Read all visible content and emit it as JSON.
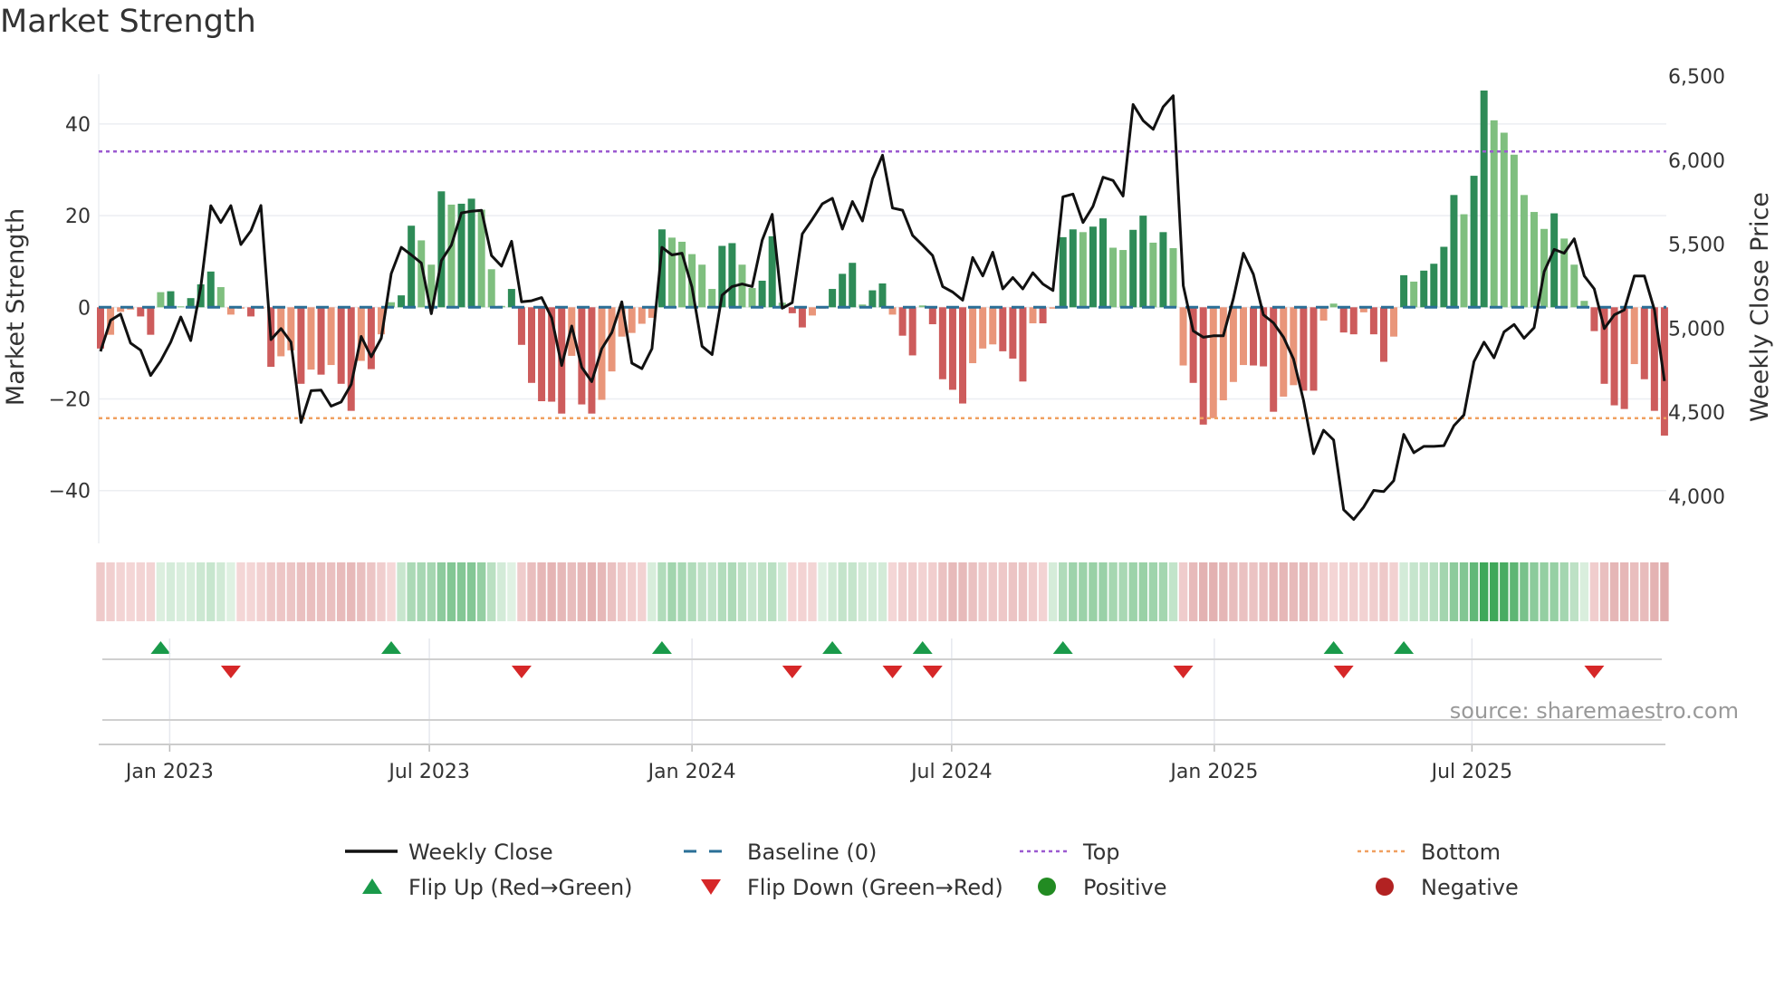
{
  "title": "Market Strength",
  "source": "source: sharemaestro.com",
  "chart_data": {
    "type": "bar",
    "title": "Market Strength",
    "ylabel": "Market Strength",
    "y2label": "Weekly Close Price",
    "ylim": [
      -52,
      52
    ],
    "y2lim": [
      3740,
      6540
    ],
    "yticks": [
      40,
      20,
      0,
      -20,
      -40
    ],
    "yticks_labels": [
      "40",
      "20",
      "0",
      "−20",
      "−40"
    ],
    "y2ticks": [
      6500,
      6000,
      5500,
      5000,
      4500,
      4000
    ],
    "y2ticks_labels": [
      "6,500",
      "6,000",
      "5,500",
      "5,000",
      "4,500",
      "4,000"
    ],
    "xticks_week_index": [
      6.9,
      32.8,
      59,
      84.9,
      111.1,
      136.8
    ],
    "xticks_labels": [
      "Jan 2023",
      "Jul 2023",
      "Jan 2024",
      "Jul 2024",
      "Jan 2025",
      "Jul 2025"
    ],
    "top_level": 34,
    "bottom_level": -24.2,
    "baseline": 0,
    "strength": [
      -9,
      -6,
      -1,
      -0.5,
      -2,
      -6,
      3.3,
      3.5,
      0.2,
      2,
      5,
      7.8,
      4.4,
      -1.6,
      -0.3,
      -2,
      -0.3,
      -13,
      -10.7,
      -9.4,
      -16.7,
      -13.6,
      -14.7,
      -12.6,
      -16.7,
      -22.6,
      -11.7,
      -13.5,
      -5.9,
      1.1,
      2.6,
      17.8,
      14.6,
      9.3,
      25.3,
      22.4,
      22.6,
      23.7,
      21.3,
      8.3,
      0.3,
      4,
      -8.2,
      -16.5,
      -20.5,
      -20.6,
      -23.2,
      -10.6,
      -21.2,
      -23.2,
      -20.2,
      -14,
      -6.4,
      -5.6,
      -3.6,
      -2.3,
      17,
      15.2,
      14.3,
      11.6,
      9.3,
      4,
      13.4,
      14,
      9.3,
      4.2,
      5.8,
      15.5,
      1,
      -1.3,
      -4.4,
      -1.8,
      -0.3,
      4,
      7.3,
      9.7,
      0.6,
      3.7,
      5.2,
      -1.6,
      -6.2,
      -10.5,
      0.4,
      -3.7,
      -15.7,
      -18,
      -21,
      -12.2,
      -9,
      -8.1,
      -9.6,
      -11.2,
      -16.2,
      -3.5,
      -3.5,
      -0.3,
      15.3,
      17,
      16.4,
      17.6,
      19.4,
      13,
      12.5,
      16.9,
      20,
      14.1,
      16.4,
      12.9,
      -12.7,
      -16.5,
      -25.6,
      -24.2,
      -20.3,
      -16.3,
      -12.6,
      -12.7,
      -12.9,
      -22.8,
      -19.5,
      -17,
      -18.2,
      -18.2,
      -2.9,
      0.8,
      -5.5,
      -5.9,
      -1.1,
      -5.9,
      -11.9,
      -6.4,
      7,
      5.6,
      8,
      9.5,
      13.2,
      24.5,
      20.3,
      28.7,
      47.3,
      40.8,
      38.1,
      33.3,
      24.5,
      20.8,
      17.1,
      20.5,
      15,
      9.3,
      1.4,
      -5.2,
      -16.7,
      -21.4,
      -22.2,
      -12.4,
      -15.7,
      -22.6,
      -28
    ],
    "weekly_close": [
      4862,
      5047,
      5084,
      4911,
      4869,
      4719,
      4805,
      4917,
      5067,
      4926,
      5244,
      5729,
      5629,
      5729,
      5498,
      5580,
      5730,
      4932,
      4998,
      4917,
      4439,
      4628,
      4632,
      4536,
      4561,
      4666,
      4951,
      4830,
      4940,
      5325,
      5481,
      5436,
      5388,
      5086,
      5402,
      5494,
      5686,
      5696,
      5701,
      5432,
      5369,
      5517,
      5157,
      5163,
      5182,
      5061,
      4778,
      5013,
      4767,
      4682,
      4878,
      4974,
      5157,
      4792,
      4759,
      4878,
      5481,
      5436,
      5446,
      5244,
      4893,
      4843,
      5196,
      5248,
      5263,
      5248,
      5523,
      5677,
      5119,
      5152,
      5561,
      5648,
      5740,
      5773,
      5590,
      5754,
      5638,
      5888,
      6029,
      5715,
      5702,
      5552,
      5494,
      5432,
      5248,
      5215,
      5167,
      5421,
      5311,
      5452,
      5234,
      5301,
      5234,
      5330,
      5263,
      5224,
      5782,
      5798,
      5629,
      5725,
      5898,
      5879,
      5786,
      6331,
      6235,
      6183,
      6317,
      6383,
      5253,
      4984,
      4946,
      4955,
      4955,
      5176,
      5446,
      5321,
      5080,
      5032,
      4946,
      4817,
      4570,
      4253,
      4393,
      4335,
      3920,
      3862,
      3936,
      4035,
      4028,
      4093,
      4368,
      4259,
      4297,
      4297,
      4301,
      4420,
      4484,
      4801,
      4917,
      4824,
      4978,
      5022,
      4940,
      5003,
      5336,
      5469,
      5446,
      5532,
      5311,
      5234,
      4998,
      5080,
      5109,
      5311,
      5311,
      5109,
      4686
    ],
    "flip_up_week_index": [
      6,
      29,
      56,
      73,
      82,
      96,
      123,
      130
    ],
    "flip_down_week_index": [
      13,
      42,
      69,
      79,
      83,
      108,
      124,
      149
    ],
    "legend": {
      "placement": "bottom",
      "items": [
        {
          "label": "Weekly Close",
          "kind": "line"
        },
        {
          "label": "Baseline (0)",
          "kind": "dash"
        },
        {
          "label": "Top",
          "kind": "dot"
        },
        {
          "label": "Bottom",
          "kind": "dot"
        },
        {
          "label": "Flip Up (Red→Green)",
          "kind": "tri-up"
        },
        {
          "label": "Flip Down (Green→Red)",
          "kind": "tri-down"
        },
        {
          "label": "Positive",
          "kind": "circle"
        },
        {
          "label": "Negative",
          "kind": "circle"
        }
      ]
    }
  },
  "colors": {
    "pos_strong": "#2e8b57",
    "pos_weak": "#7fbf7f",
    "neg_strong": "#cd5c5c",
    "neg_weak": "#e9967a",
    "close": "#111111",
    "baseline": "#2a6f97",
    "top": "#9b59d0",
    "bottom": "#f0a060",
    "flip_up": "#1a9a4a",
    "flip_down": "#d62728",
    "positive": "#228b22",
    "negative": "#b22222"
  }
}
